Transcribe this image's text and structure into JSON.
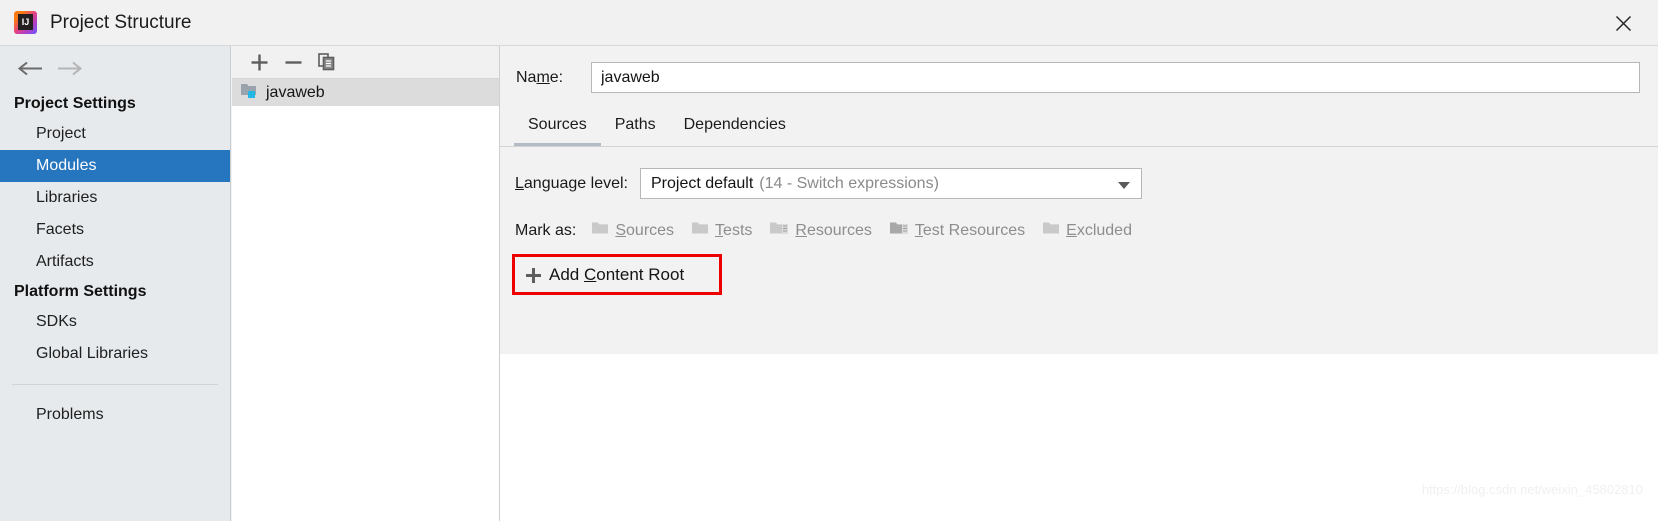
{
  "window": {
    "title": "Project Structure",
    "logo_icon": "intellij-idea-logo",
    "close_icon": "close-icon"
  },
  "sidebar": {
    "back_icon": "arrow-left-icon",
    "forward_icon": "arrow-right-icon",
    "groups": [
      {
        "header": "Project Settings",
        "items": [
          {
            "label": "Project",
            "selected": false
          },
          {
            "label": "Modules",
            "selected": true
          },
          {
            "label": "Libraries",
            "selected": false
          },
          {
            "label": "Facets",
            "selected": false
          },
          {
            "label": "Artifacts",
            "selected": false
          }
        ]
      },
      {
        "header": "Platform Settings",
        "items": [
          {
            "label": "SDKs",
            "selected": false
          },
          {
            "label": "Global Libraries",
            "selected": false
          }
        ]
      }
    ],
    "problems_label": "Problems",
    "selection_color": "#2675bf",
    "background_color": "#e6eaed"
  },
  "modules_panel": {
    "toolbar": {
      "add_icon": "plus-icon",
      "remove_icon": "minus-icon",
      "copy_icon": "copy-icon"
    },
    "items": [
      {
        "label": "javaweb",
        "icon": "module-folder-icon",
        "selected": true
      }
    ]
  },
  "detail": {
    "name_field": {
      "label": "Name:",
      "label_mnemonic": "m",
      "value": "javaweb"
    },
    "tabs": [
      {
        "label": "Sources",
        "active": true
      },
      {
        "label": "Paths",
        "active": false
      },
      {
        "label": "Dependencies",
        "active": false
      }
    ],
    "language_level": {
      "label": "Language level:",
      "label_mnemonic": "L",
      "value_main": "Project default",
      "value_detail": "(14 - Switch expressions)",
      "dropdown_icon": "chevron-down-icon"
    },
    "mark_as": {
      "label": "Mark as:",
      "options": [
        {
          "label": "Sources",
          "mnemonic": "S",
          "icon": "folder-sources-icon",
          "enabled": false
        },
        {
          "label": "Tests",
          "mnemonic": "T",
          "icon": "folder-tests-icon",
          "enabled": false
        },
        {
          "label": "Resources",
          "mnemonic": "R",
          "icon": "folder-resources-icon",
          "enabled": false
        },
        {
          "label": "Test Resources",
          "mnemonic": "T",
          "icon": "folder-test-resources-icon",
          "enabled": false
        },
        {
          "label": "Excluded",
          "mnemonic": "E",
          "icon": "folder-excluded-icon",
          "enabled": false
        }
      ]
    },
    "add_content_root": {
      "label_pre": "Add ",
      "label_mnemonic": "C",
      "label_post": "ontent Root",
      "icon": "plus-icon",
      "highlight_color": "#ee0000"
    }
  },
  "watermark": {
    "text": "https://blog.csdn.net/weixin_45802810"
  }
}
